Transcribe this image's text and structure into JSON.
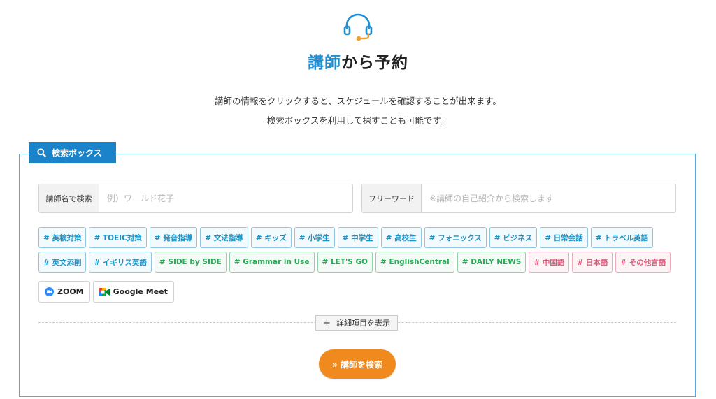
{
  "header": {
    "icon": "headset-icon",
    "title_accent": "講師",
    "title_rest": "から予約",
    "desc_line1": "講師の情報をクリックすると、スケジュールを確認することが出来ます。",
    "desc_line2": "検索ボックスを利用して探すことも可能です。"
  },
  "search_box": {
    "label": "検索ボックス",
    "label_icon": "search-icon",
    "name_field": {
      "label": "講師名で検索",
      "value": "",
      "placeholder": "例）ワールド花子"
    },
    "free_field": {
      "label": "フリーワード",
      "value": "",
      "placeholder": "※講師の自己紹介から検索します"
    },
    "tags_row1": [
      "# 英検対策",
      "# TOEIC対策",
      "# 発音指導",
      "# 文法指導",
      "# キッズ",
      "# 小学生",
      "# 中学生",
      "# 高校生",
      "# フォニックス",
      "# ビジネス",
      "# 日常会話",
      "# トラベル英語"
    ],
    "tags_row2_blue": [
      "# 英文添削",
      "# イギリス英語"
    ],
    "tags_row2_green": [
      "# SIDE by SIDE",
      "# Grammar in Use",
      "# LET'S GO",
      "# EnglishCentral",
      "# DAILY NEWS"
    ],
    "tags_row2_pink": [
      "# 中国語",
      "# 日本語",
      "# その他言語"
    ],
    "tools": [
      {
        "label": "ZOOM",
        "icon": "zoom-icon"
      },
      {
        "label": "Google Meet",
        "icon": "google-meet-icon"
      }
    ],
    "detail_button": "詳細項目を表示",
    "submit_button": "» 講師を検索"
  },
  "colors": {
    "accent_blue": "#1e8fd5",
    "label_blue": "#1b83c9",
    "tag_blue": "#1a93c6",
    "tag_green": "#27a957",
    "tag_pink": "#e0577a",
    "submit_orange": "#f08a1e"
  }
}
